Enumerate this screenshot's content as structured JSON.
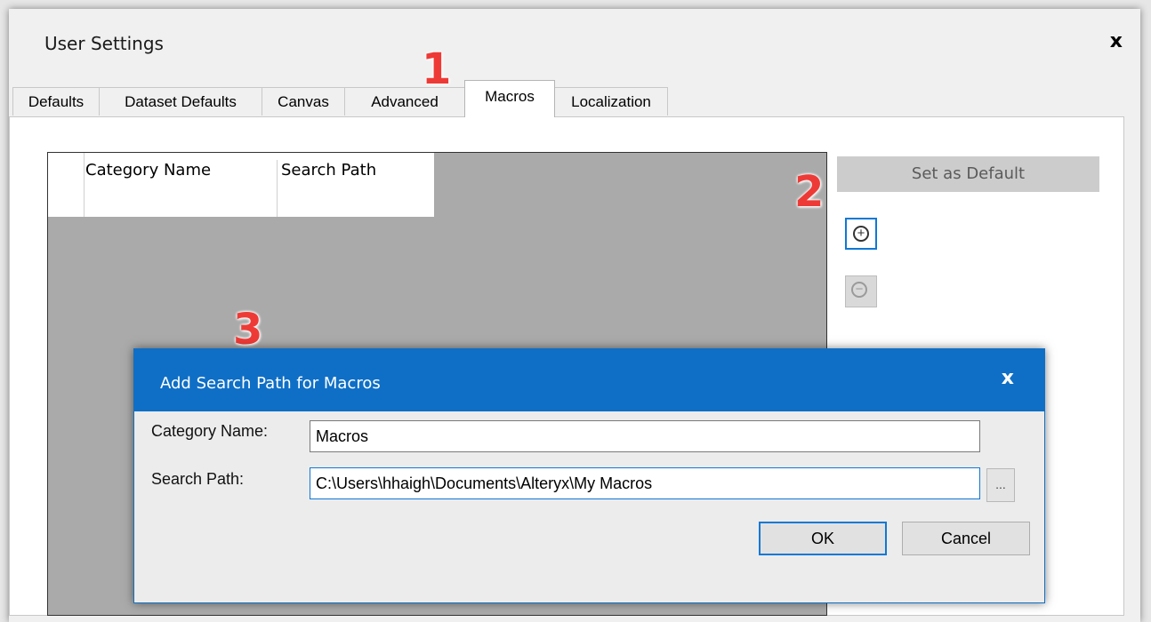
{
  "window": {
    "title": "User Settings",
    "close_glyph": "x"
  },
  "tabs": [
    {
      "label": "Defaults"
    },
    {
      "label": "Dataset Defaults"
    },
    {
      "label": "Canvas"
    },
    {
      "label": "Advanced"
    },
    {
      "label": "Macros",
      "active": true
    },
    {
      "label": "Localization"
    }
  ],
  "grid": {
    "col1_header": "Category Name",
    "col2_header": "Search Path"
  },
  "side": {
    "set_default_label": "Set as Default",
    "add_icon": "plus-circle-icon",
    "remove_icon": "minus-circle-icon"
  },
  "annotations": [
    "1",
    "2",
    "3"
  ],
  "dialog": {
    "title": "Add Search Path for Macros",
    "close_glyph": "x",
    "category_label": "Category Name:",
    "category_value": "Macros",
    "path_label": "Search Path:",
    "path_value": "C:\\Users\\hhaigh\\Documents\\Alteryx\\My Macros",
    "browse_label": "...",
    "ok_label": "OK",
    "cancel_label": "Cancel"
  },
  "colors": {
    "accent": "#0f6fc6",
    "annotation": "#ee3a36",
    "grid_bg": "#aaaaaa"
  }
}
